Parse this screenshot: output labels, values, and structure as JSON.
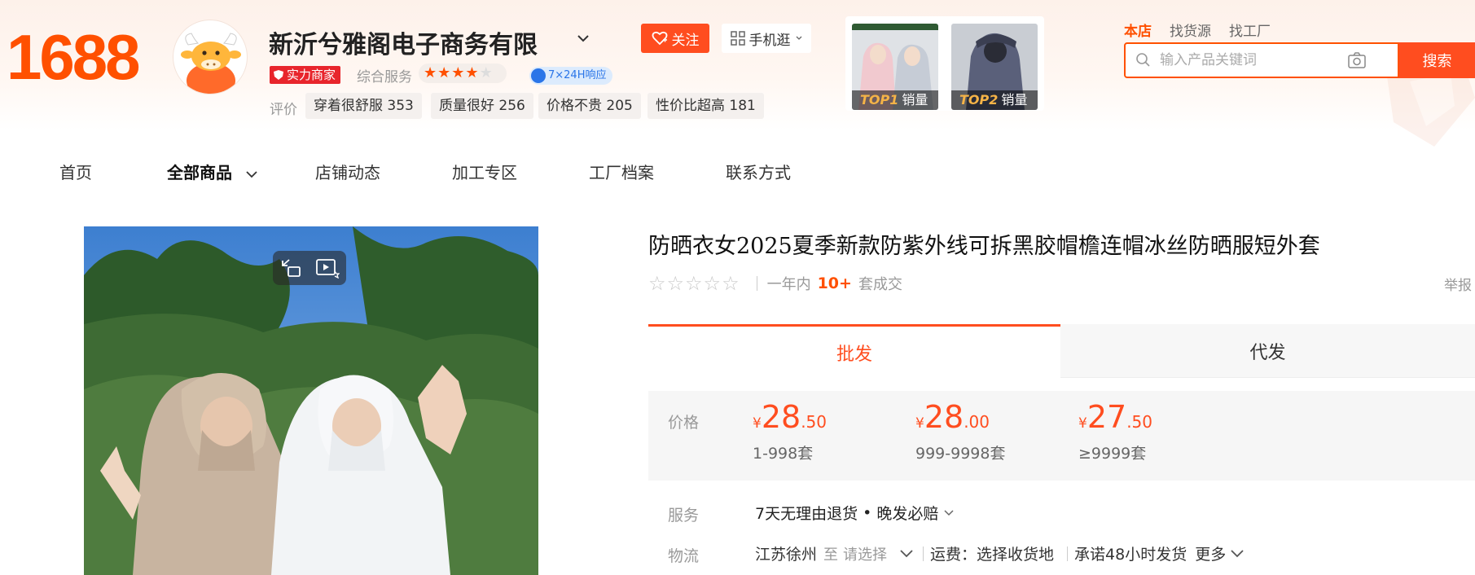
{
  "brand": {
    "logo_text": "1688",
    "accent": "#ff5000"
  },
  "shop": {
    "name": "新沂兮雅阁电子商务有限",
    "badge": "实力商家",
    "service_label": "综合服务",
    "service_rating": 4,
    "service_rating_max": 5,
    "response_badge": "7×24H响应",
    "evaluation_label": "评价",
    "evaluation_tags": [
      {
        "text": "穿着很舒服",
        "count": "353"
      },
      {
        "text": "质量很好",
        "count": "256"
      },
      {
        "text": "价格不贵",
        "count": "205"
      },
      {
        "text": "性价比超高",
        "count": "181"
      }
    ],
    "follow_button": "关注",
    "mobile_button": "手机逛"
  },
  "top_products": [
    {
      "rank": "TOP1",
      "label": "销量"
    },
    {
      "rank": "TOP2",
      "label": "销量"
    }
  ],
  "search": {
    "tabs": [
      "本店",
      "找货源",
      "找工厂"
    ],
    "active_tab": "本店",
    "placeholder": "输入产品关键词",
    "button": "搜索"
  },
  "nav": {
    "items": [
      "首页",
      "全部商品",
      "店铺动态",
      "加工专区",
      "工厂档案",
      "联系方式"
    ],
    "active": "全部商品"
  },
  "product": {
    "title": "防晒衣女2025夏季新款防紫外线可拆黑胶帽檐连帽冰丝防晒服短外套",
    "rating_stars": 0,
    "sales_prefix": "一年内",
    "sales_count": "10+",
    "sales_suffix": "套成交",
    "report": "举报",
    "tabs": {
      "wholesale": "批发",
      "dropship": "代发"
    },
    "price_label": "价格",
    "prices": [
      {
        "currency": "¥",
        "int": "28",
        "dec": ".50",
        "range": "1-998套"
      },
      {
        "currency": "¥",
        "int": "28",
        "dec": ".00",
        "range": "999-9998套"
      },
      {
        "currency": "¥",
        "int": "27",
        "dec": ".50",
        "range": "≥9999套"
      }
    ],
    "service_label": "服务",
    "service_text": "7天无理由退货",
    "service_dot": "•",
    "service_text2": "晚发必赔",
    "logistics_label": "物流",
    "origin": "江苏徐州",
    "to": "至",
    "select": "请选择",
    "freight": "运费：选择收货地",
    "promise": "承诺48小时发货",
    "more": "更多"
  }
}
